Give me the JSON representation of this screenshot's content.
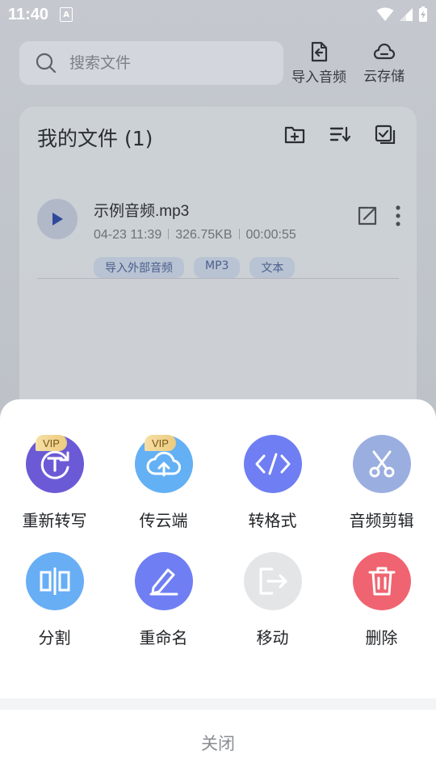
{
  "status_bar": {
    "time": "11:40",
    "notification_glyph": "A"
  },
  "search": {
    "placeholder": "搜索文件"
  },
  "top_actions": {
    "import_audio": "导入音频",
    "cloud_storage": "云存储"
  },
  "files_card": {
    "title": "我的文件 (1)",
    "file": {
      "name": "示例音频.mp3",
      "date": "04-23 11:39",
      "size": "326.75KB",
      "duration": "00:00:55",
      "tags": [
        "导入外部音频",
        "MP3",
        "文本"
      ]
    }
  },
  "sheet": {
    "options": [
      {
        "label": "重新转写",
        "vip": "VIP",
        "color": "#6b5ad6"
      },
      {
        "label": "传云端",
        "vip": "VIP",
        "color": "#64b0f4"
      },
      {
        "label": "转格式",
        "color": "#6f7ef2"
      },
      {
        "label": "音频剪辑",
        "color": "#9aaee0"
      },
      {
        "label": "分割",
        "color": "#67aef5"
      },
      {
        "label": "重命名",
        "color": "#6f7ef2"
      },
      {
        "label": "移动",
        "color": "#e4e5e7"
      },
      {
        "label": "删除",
        "color": "#ef6470"
      }
    ],
    "close_label": "关闭"
  }
}
